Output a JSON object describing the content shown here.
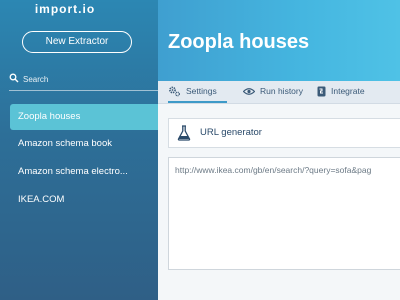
{
  "sidebar": {
    "brand": "import.io",
    "new_extractor_label": "New Extractor",
    "search": {
      "placeholder": "Search",
      "icon": "search-icon"
    },
    "items": [
      {
        "label": "Zoopla houses",
        "active": true
      },
      {
        "label": "Amazon schema book",
        "active": false
      },
      {
        "label": "Amazon schema electro...",
        "active": false
      },
      {
        "label": "IKEA.COM",
        "active": false
      }
    ]
  },
  "header": {
    "title": "Zoopla houses"
  },
  "tabs": [
    {
      "label": "Settings",
      "icon": "gear-icon",
      "active": true
    },
    {
      "label": "Run history",
      "icon": "eye-icon",
      "active": false
    },
    {
      "label": "Integrate",
      "icon": "integrate-icon",
      "active": false
    }
  ],
  "main": {
    "url_generator_label": "URL generator",
    "url_generator_icon": "flask-icon",
    "url_text": "http://www.ikea.com/gb/en/search/?query=sofa&pag"
  },
  "colors": {
    "sidebar_top": "#2c87b3",
    "sidebar_bottom": "#2f5f86",
    "active_item": "#5bc3d6",
    "header": "#45b6e0",
    "tab_underline": "#3d9ac8"
  }
}
